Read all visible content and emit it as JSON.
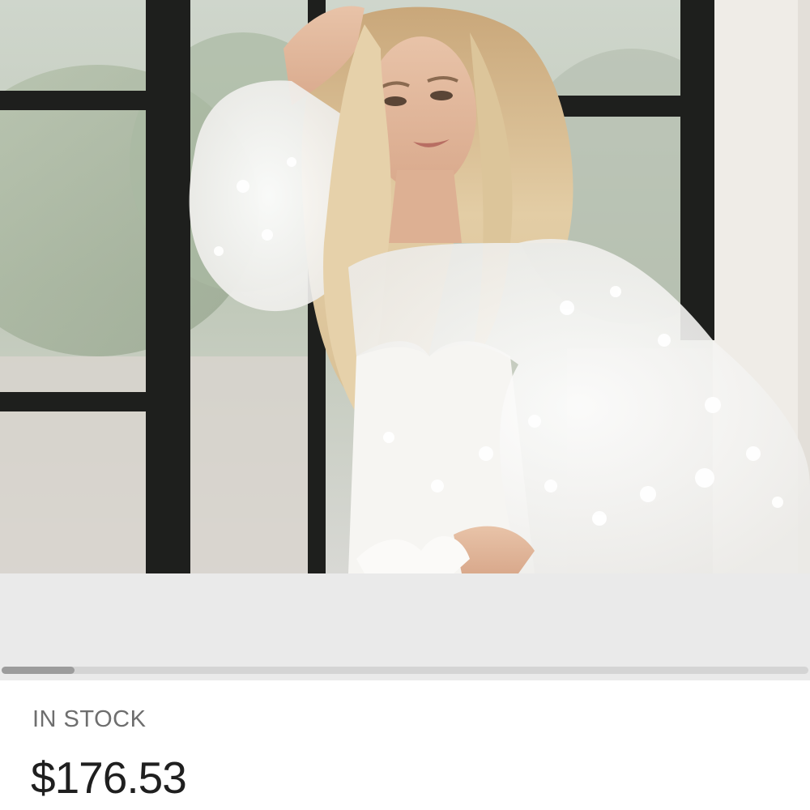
{
  "product": {
    "image_alt": "Woman in white lace long-sleeve bridal top standing by a black-framed window",
    "gallery": {
      "current_index": 1,
      "scroll_fraction": 0.09
    },
    "stock_status": "IN STOCK",
    "price": "$176.53"
  },
  "colors": {
    "gallery_background": "#eaeaea",
    "scroll_track": "#d4d4d4",
    "scroll_thumb": "#9c9c9c",
    "stock_text": "#6e6e6e",
    "price_text": "#1f1f1f"
  }
}
